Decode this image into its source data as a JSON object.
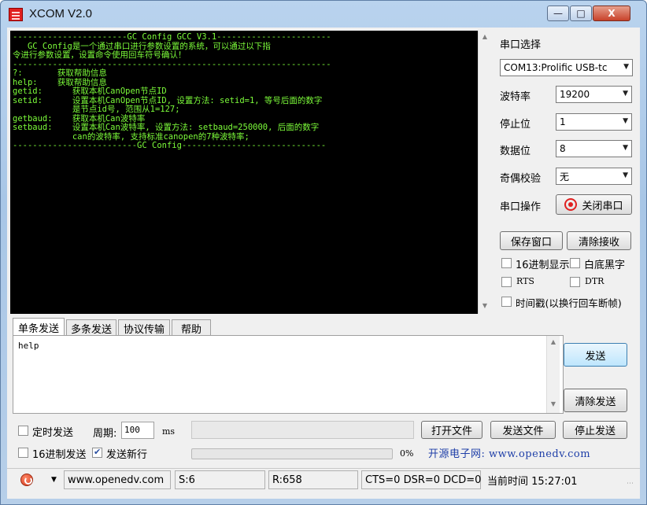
{
  "window": {
    "title": "XCOM V2.0"
  },
  "terminal": {
    "lines": [
      "-----------------------GC Config GCC V3.1-----------------------",
      "   GC Config是一个通过串口进行参数设置的系统，可以通过以下指",
      "令进行参数设置，设置命令使用回车符号确认！",
      "----------------------------------------------------------------",
      "?:       获取帮助信息",
      "help:    获取帮助信息",
      "getid:      获取本机CanOpen节点ID",
      "setid:      设置本机CanOpen节点ID, 设置方法: setid=1, 等号后面的数字",
      "            是节点id号, 范围从1=127;",
      "getbaud:    获取本机Can波特率",
      "setbaud:    设置本机Can波特率, 设置方法: setbaud=250000, 后面的数字",
      "            can的波特率, 支持标准canopen的7种波特率;",
      "-------------------------GC Config-----------------------------"
    ]
  },
  "serial": {
    "port_select_label": "串口选择",
    "port_value": "COM13:Prolific USB-tc",
    "baud_label": "波特率",
    "baud_value": "19200",
    "stop_label": "停止位",
    "stop_value": "1",
    "data_label": "数据位",
    "data_value": "8",
    "parity_label": "奇偶校验",
    "parity_value": "无",
    "op_label": "串口操作",
    "close_port_label": "关闭串口"
  },
  "options": {
    "save_window": "保存窗口",
    "clear_receive": "清除接收",
    "hex_display": "16进制显示",
    "white_bg": "白底黑字",
    "rts": "RTS",
    "dtr": "DTR",
    "timestamp": "时间戳(以换行回车断帧)"
  },
  "tabs": [
    "单条发送",
    "多条发送",
    "协议传输",
    "帮助"
  ],
  "send": {
    "input_text": "help",
    "send_label": "发送",
    "clear_send_label": "清除发送",
    "timed_send": "定时发送",
    "period_label": "周期:",
    "period_value": "100",
    "period_unit": "ms",
    "open_file": "打开文件",
    "send_file": "发送文件",
    "stop_send": "停止发送",
    "hex_send": "16进制发送",
    "send_newline": "发送新行",
    "progress_text": "0%",
    "progress": 0,
    "promo": "开源电子网: www.openedv.com"
  },
  "status": {
    "url": "www.openedv.com",
    "sent": "S:6",
    "received": "R:658",
    "lines": "CTS=0 DSR=0 DCD=0",
    "time": "当前时间 15:27:01"
  },
  "icons": {
    "app": "xcom-app-icon",
    "close_port": "red-target-icon",
    "status": "power-icon"
  },
  "colors": {
    "terminal_bg": "#000000",
    "terminal_text": "#7cfc3a",
    "promo_text": "#1f3fa8",
    "close_port_icon": "#e02020"
  }
}
